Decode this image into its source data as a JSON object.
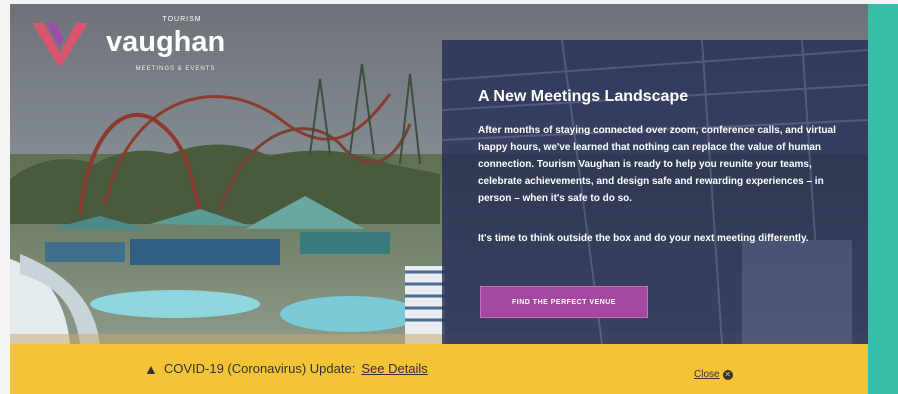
{
  "logo": {
    "top_text": "TOURISM",
    "name": "vaughan",
    "sub_text": "MEETINGS & EVENTS"
  },
  "panel": {
    "title": "A New Meetings Landscape",
    "body": "After months of staying connected over zoom, conference calls, and virtual happy hours, we've learned that nothing can replace the value of human connection. Tourism Vaughan is ready to help you reunite your teams, celebrate achievements, and design safe and rewarding experiences – in person – when it's safe to do so.",
    "body2": "It's time to think outside the box and do your next meeting differently.",
    "button_label": "FIND THE PERFECT VENUE"
  },
  "alert": {
    "message": "COVID-19 (Coronavirus) Update:",
    "link_label": "See Details",
    "close_label": "Close"
  },
  "icons": {
    "warning": "warning-triangle-icon",
    "close": "close-circle-icon"
  },
  "colors": {
    "alert_bar": "#f4c437",
    "panel_bg": "#272d56",
    "button": "#a3479f",
    "teal_strip": "#37bfaa"
  }
}
